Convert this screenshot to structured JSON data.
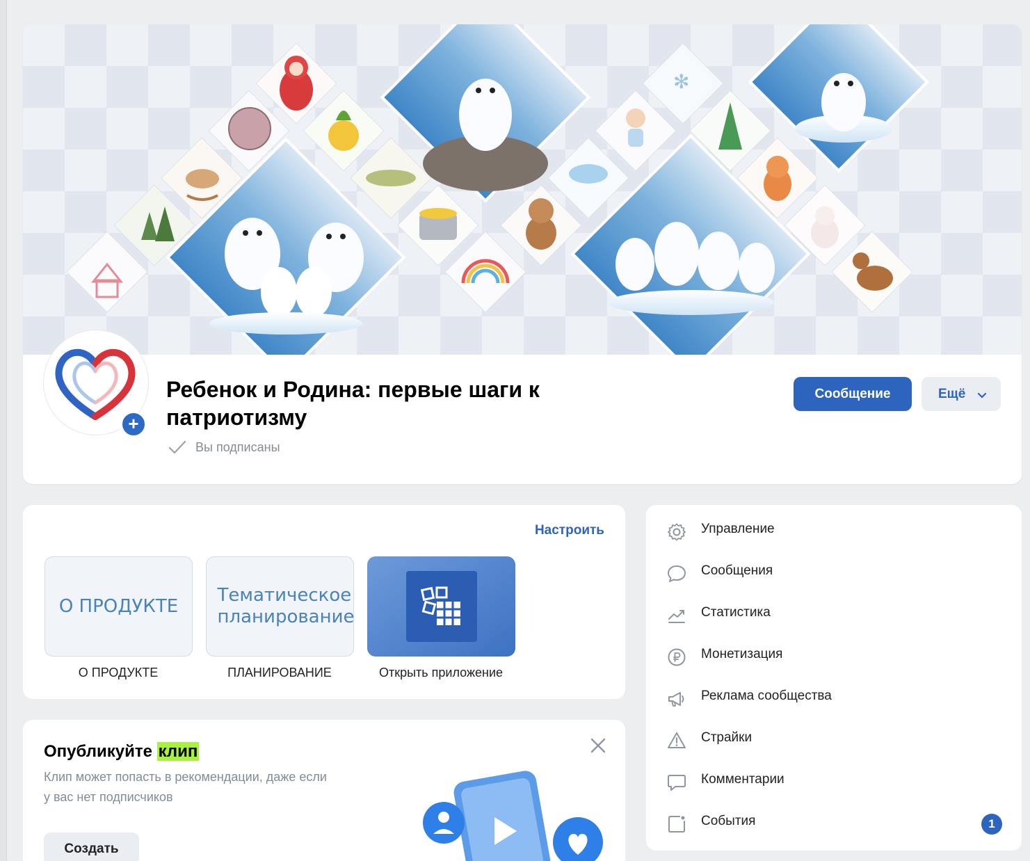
{
  "group": {
    "title": "Ребенок и Родина: первые шаги к патриотизму",
    "subscribed_label": "Вы подписаны",
    "message_button": "Сообщение",
    "more_button": "Ещё"
  },
  "apps": {
    "setup_label": "Настроить",
    "tiles": [
      {
        "tile_text": "О ПРОДУКТЕ",
        "label": "О ПРОДУКТЕ"
      },
      {
        "tile_text": "Тематическое планирование",
        "label": "ПЛАНИРОВАНИЕ"
      },
      {
        "tile_text": "",
        "label": "Открыть приложение"
      }
    ]
  },
  "clip_promo": {
    "title_prefix": "Опубликуйте ",
    "title_highlight": "клип",
    "description": "Клип может попасть в рекомендации, даже если у вас нет подписчиков",
    "create_button": "Создать"
  },
  "management_menu": {
    "items": [
      {
        "label": "Управление",
        "icon": "gear-icon"
      },
      {
        "label": "Сообщения",
        "icon": "chat-bubble-icon"
      },
      {
        "label": "Статистика",
        "icon": "chart-trend-icon"
      },
      {
        "label": "Монетизация",
        "icon": "ruble-coin-icon"
      },
      {
        "label": "Реклама сообщества",
        "icon": "megaphone-icon"
      },
      {
        "label": "Страйки",
        "icon": "warning-triangle-icon"
      },
      {
        "label": "Комментарии",
        "icon": "comment-icon"
      },
      {
        "label": "События",
        "icon": "calendar-event-icon",
        "badge": "1"
      }
    ]
  },
  "colors": {
    "accent": "#2d64bd",
    "page_bg": "#edeef0",
    "highlight": "#a6f23c"
  }
}
